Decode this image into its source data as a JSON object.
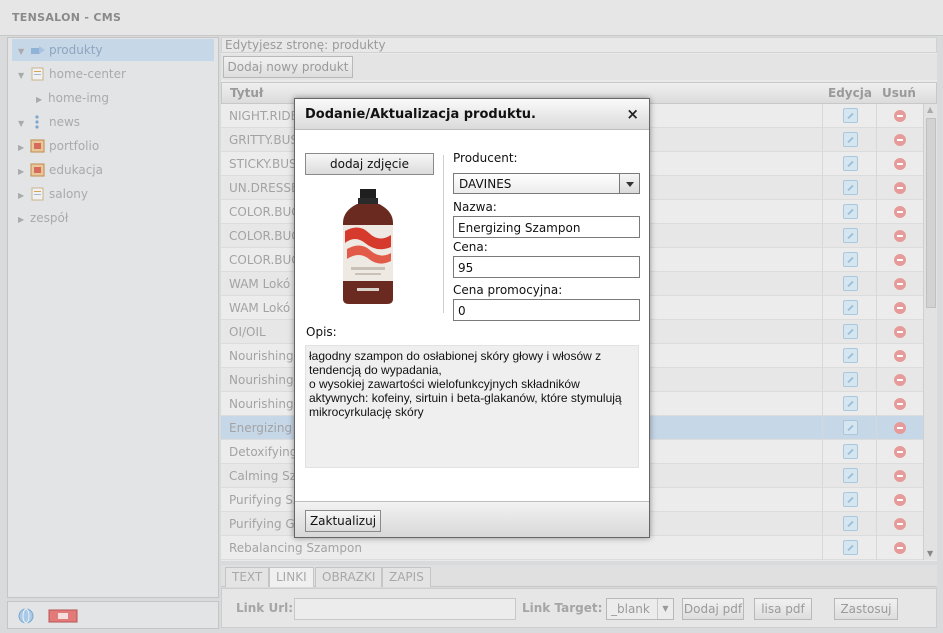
{
  "app": {
    "title": "TENSALON - CMS"
  },
  "sidebar": {
    "items": [
      {
        "label": "produkty",
        "icon": "folder-blue-icon",
        "selected": true
      },
      {
        "label": "home-center",
        "icon": "page-icon"
      },
      {
        "label": "home-img",
        "icon": "none"
      },
      {
        "label": "news",
        "icon": "dots-icon"
      },
      {
        "label": "portfolio",
        "icon": "gallery-icon"
      },
      {
        "label": "edukacja",
        "icon": "gallery-icon"
      },
      {
        "label": "salony",
        "icon": "page-icon"
      },
      {
        "label": "zespół",
        "icon": "none"
      }
    ]
  },
  "main": {
    "breadcrumb": "Edytyjesz stronę: produkty",
    "add_button": "Dodaj nowy produkt",
    "columns": {
      "title": "Tytuł",
      "edit": "Edycja",
      "delete": "Usuń"
    },
    "rows": [
      "NIGHT.RIDE",
      "GRITTY.BUS",
      "STICKY.BUS",
      "UN.DRESSE",
      "COLOR.BUG",
      "COLOR.BUG",
      "COLOR.BUG",
      "WAM Lokó",
      "WAM Lokó",
      "OI/OIL",
      "Nourishing S",
      "Nourishing V",
      "Nourishing H",
      "Energizing S",
      "Detoxifying",
      "Calming Szar",
      "Purifying Sz",
      "Purifying Ge",
      "Rebalancing Szampon"
    ],
    "selected_row": 13
  },
  "bottom": {
    "tabs": [
      "TEXT",
      "LINKI",
      "OBRAZKI",
      "ZAPIS"
    ],
    "active_tab": 1,
    "link_url_label": "Link Url:",
    "link_target_label": "Link Target:",
    "link_target_value": "_blank",
    "btn_pdf": "Dodaj pdf",
    "btn_list": "lisa pdf",
    "btn_apply": "Zastosuj"
  },
  "modal": {
    "title": "Dodanie/Aktualizacja produktu.",
    "close": "×",
    "add_photo": "dodaj zdjęcie",
    "producer_label": "Producent:",
    "producer_value": "DAVINES",
    "name_label": "Nazwa:",
    "name_value": "Energizing Szampon",
    "price_label": "Cena:",
    "price_value": "95",
    "promo_label": "Cena promocyjna:",
    "promo_value": "0",
    "desc_label": "Opis:",
    "desc_value": "łagodny szampon do osłabionej skóry głowy i włosów z tendencją do wypadania,\no wysokiej zawartości wielofunkcyjnych składników aktywnych: kofeiny, sirtuin i beta-glakanów, które stymulują mikrocyrkulację skóry",
    "submit": "Zaktualizuj"
  },
  "colors": {
    "selection": "#c6d7e8",
    "delete": "#e69a9a",
    "edit": "#a9c8dc"
  }
}
